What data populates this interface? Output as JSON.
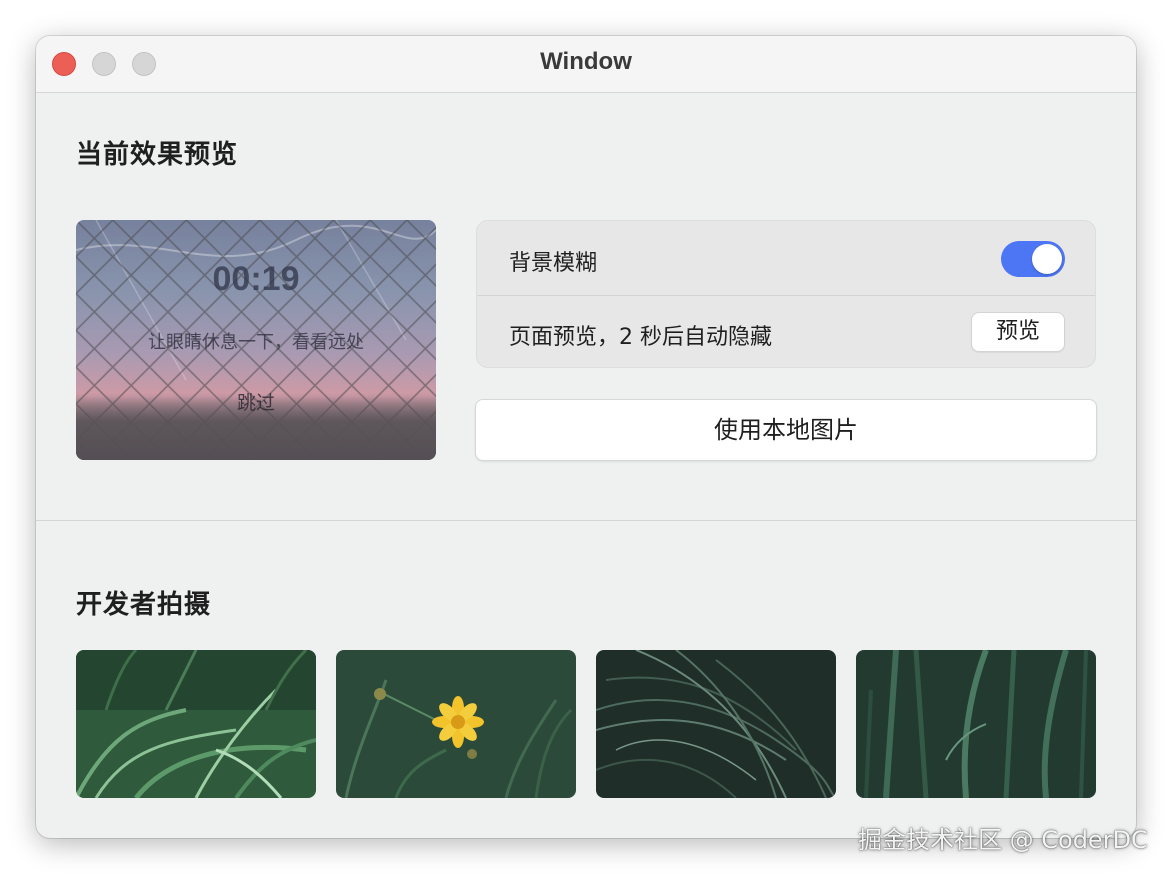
{
  "window": {
    "title": "Window"
  },
  "preview_section": {
    "title": "当前效果预览",
    "timer": "00:19",
    "hint": "让眼睛休息一下，看看远处",
    "skip_label": "跳过"
  },
  "settings": {
    "blur": {
      "label": "背景模糊",
      "enabled": true
    },
    "page_preview": {
      "label": "页面预览，2 秒后自动隐藏",
      "button_label": "预览"
    },
    "local_image_button": "使用本地图片"
  },
  "developer_section": {
    "title": "开发者拍摄",
    "photos": [
      {
        "icon": "grass-photo"
      },
      {
        "icon": "yellow-flower-photo"
      },
      {
        "icon": "dark-grass-photo"
      },
      {
        "icon": "green-stems-photo"
      }
    ]
  },
  "watermark": "掘金技术社区 @ CoderDC",
  "colors": {
    "toggle_on": "#4d76f5",
    "close_button": "#ec5f56",
    "window_bg": "#eff1f0"
  }
}
